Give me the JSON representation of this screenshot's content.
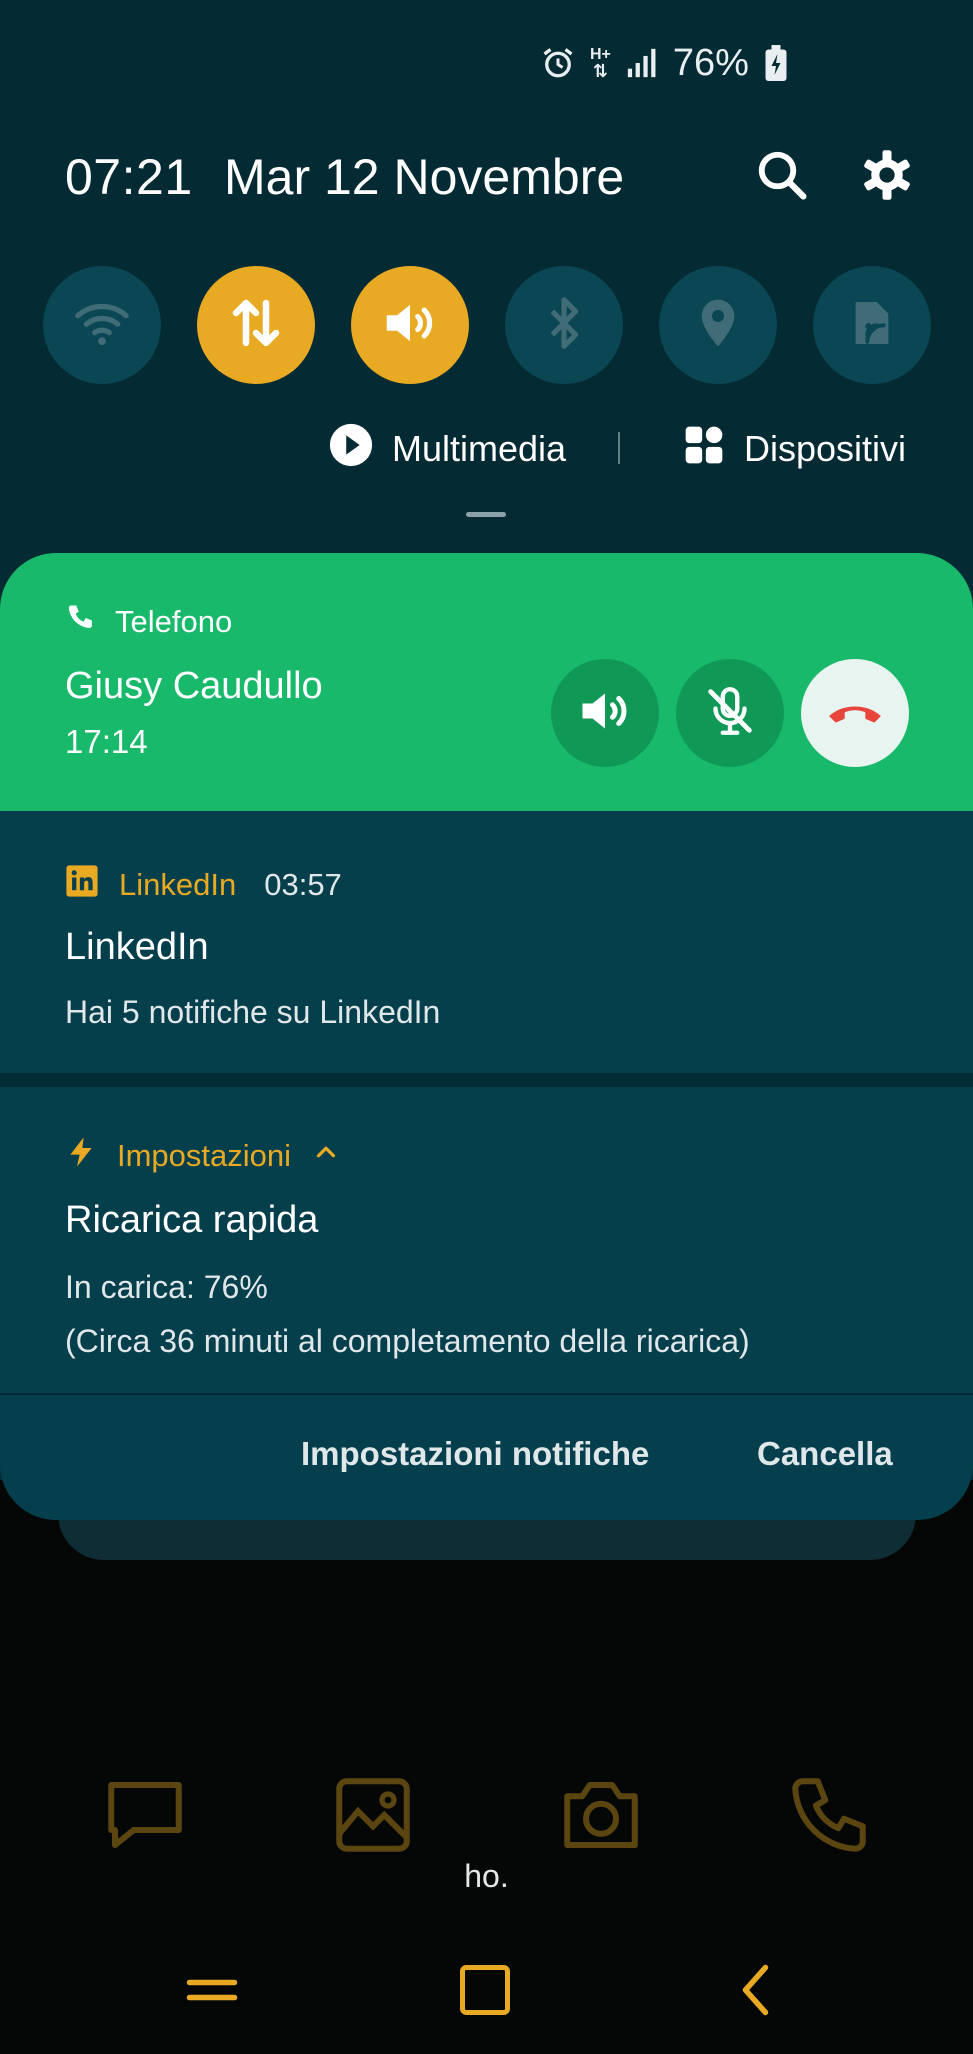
{
  "status_bar": {
    "battery_percent": "76%",
    "network": "H+"
  },
  "header": {
    "time": "07:21",
    "date": "Mar 12 Novembre"
  },
  "quick_toggles": [
    {
      "name": "wifi",
      "state": "off"
    },
    {
      "name": "mobile-data",
      "state": "on"
    },
    {
      "name": "sound",
      "state": "on"
    },
    {
      "name": "bluetooth",
      "state": "off"
    },
    {
      "name": "location",
      "state": "off"
    },
    {
      "name": "nfc",
      "state": "off"
    }
  ],
  "media_row": {
    "multimedia_label": "Multimedia",
    "devices_label": "Dispositivi"
  },
  "call_notification": {
    "app": "Telefono",
    "caller": "Giusy Caudullo",
    "duration": "17:14"
  },
  "linkedin_notification": {
    "app": "LinkedIn",
    "time": "03:57",
    "title": "LinkedIn",
    "text": "Hai 5 notifiche su LinkedIn"
  },
  "charging_notification": {
    "app": "Impostazioni",
    "title": "Ricarica rapida",
    "line1": "In carica: 76%",
    "line2": "(Circa 36 minuti al completamento della ricarica)"
  },
  "panel_actions": {
    "settings_label": "Impostazioni notifiche",
    "clear_label": "Cancella"
  },
  "background_hint": "ho.",
  "colors": {
    "accent": "#e8a923",
    "call_green": "#18b96b",
    "panel": "#053f4d",
    "end_call_red": "#e8463c"
  }
}
